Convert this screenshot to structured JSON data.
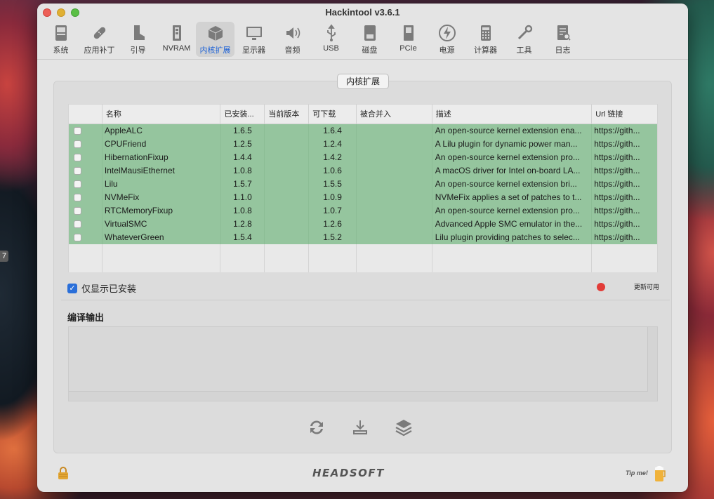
{
  "desktop": {
    "side_tab": "7"
  },
  "window": {
    "title": "Hackintool v3.6.1"
  },
  "toolbar": {
    "items": [
      {
        "label": "系统",
        "icon": "system-icon",
        "active": false
      },
      {
        "label": "应用补丁",
        "icon": "patch-icon",
        "active": false
      },
      {
        "label": "引导",
        "icon": "boot-icon",
        "active": false
      },
      {
        "label": "NVRAM",
        "icon": "nvram-icon",
        "active": false
      },
      {
        "label": "内核扩展",
        "icon": "kext-icon",
        "active": true
      },
      {
        "label": "显示器",
        "icon": "display-icon",
        "active": false
      },
      {
        "label": "音频",
        "icon": "audio-icon",
        "active": false
      },
      {
        "label": "USB",
        "icon": "usb-icon",
        "active": false
      },
      {
        "label": "磁盘",
        "icon": "disk-icon",
        "active": false
      },
      {
        "label": "PCIe",
        "icon": "pcie-icon",
        "active": false
      },
      {
        "label": "电源",
        "icon": "power-icon",
        "active": false
      },
      {
        "label": "计算器",
        "icon": "calculator-icon",
        "active": false
      },
      {
        "label": "工具",
        "icon": "tools-icon",
        "active": false
      },
      {
        "label": "日志",
        "icon": "log-icon",
        "active": false
      }
    ]
  },
  "panel": {
    "title": "内核扩展"
  },
  "table": {
    "columns": [
      "",
      "名称",
      "已安装...",
      "当前版本",
      "可下载",
      "被合并入",
      "描述",
      "Url 链接"
    ],
    "rows": [
      {
        "name": "AppleALC",
        "installed": "1.6.5",
        "current": "",
        "download": "1.6.4",
        "merged": "",
        "desc": "An open-source kernel extension ena...",
        "url": "https://gith..."
      },
      {
        "name": "CPUFriend",
        "installed": "1.2.5",
        "current": "",
        "download": "1.2.4",
        "merged": "",
        "desc": "A Lilu plugin for dynamic power man...",
        "url": "https://gith..."
      },
      {
        "name": "HibernationFixup",
        "installed": "1.4.4",
        "current": "",
        "download": "1.4.2",
        "merged": "",
        "desc": "An open-source kernel extension pro...",
        "url": "https://gith..."
      },
      {
        "name": "IntelMausiEthernet",
        "installed": "1.0.8",
        "current": "",
        "download": "1.0.6",
        "merged": "",
        "desc": "A macOS driver for Intel on-board LA...",
        "url": "https://gith..."
      },
      {
        "name": "Lilu",
        "installed": "1.5.7",
        "current": "",
        "download": "1.5.5",
        "merged": "",
        "desc": "An open-source kernel extension bri...",
        "url": "https://gith..."
      },
      {
        "name": "NVMeFix",
        "installed": "1.1.0",
        "current": "",
        "download": "1.0.9",
        "merged": "",
        "desc": "NVMeFix applies a set of patches to t...",
        "url": "https://gith..."
      },
      {
        "name": "RTCMemoryFixup",
        "installed": "1.0.8",
        "current": "",
        "download": "1.0.7",
        "merged": "",
        "desc": "An open-source kernel extension pro...",
        "url": "https://gith..."
      },
      {
        "name": "VirtualSMC",
        "installed": "1.2.8",
        "current": "",
        "download": "1.2.6",
        "merged": "",
        "desc": "Advanced Apple SMC emulator in the...",
        "url": "https://gith..."
      },
      {
        "name": "WhateverGreen",
        "installed": "1.5.4",
        "current": "",
        "download": "1.5.2",
        "merged": "",
        "desc": "Lilu plugin providing patches to selec...",
        "url": "https://gith..."
      }
    ],
    "row_color": "#95c59e"
  },
  "filter": {
    "label": "仅显示已安装",
    "checked": true
  },
  "legend": {
    "label": "更新可用",
    "color": "#e23c38"
  },
  "output": {
    "label": "编译输出",
    "text": ""
  },
  "footer": {
    "brand": "HEADSOFT",
    "tip": "Tip me!"
  }
}
